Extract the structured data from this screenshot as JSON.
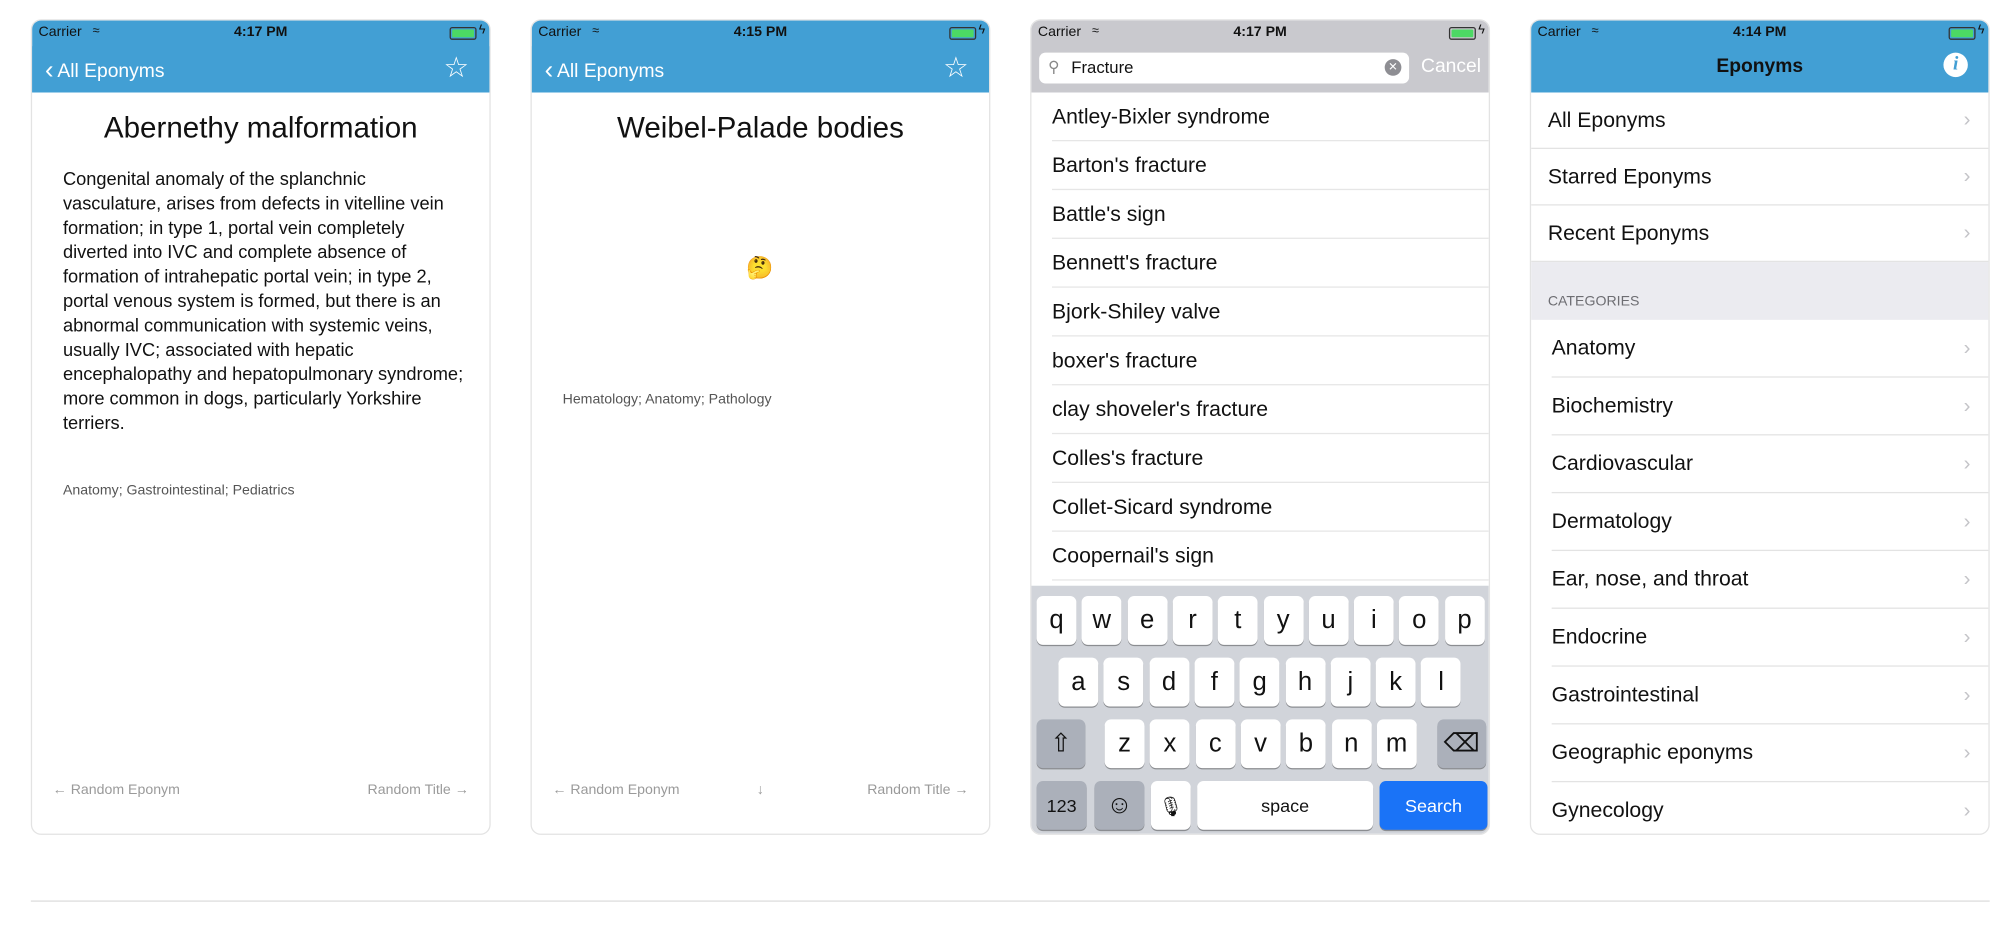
{
  "colors": {
    "nav_blue": "#429fd4",
    "search_key": "#1a73f7",
    "battery": "#4cd964"
  },
  "screen1": {
    "status": {
      "carrier": "Carrier",
      "time": "4:17 PM"
    },
    "back_label": "All Eponyms",
    "title": "Abernethy malformation",
    "description": "Congenital anomaly of the splanchnic vasculature, arises from defects in vitelline vein formation; in type 1, portal vein completely diverted into IVC and complete absence of formation of intrahepatic portal vein; in type 2, portal venous system is formed, but there is an abnormal communication with systemic veins, usually IVC; associated with hepatic encephalopathy and hepatopulmonary syndrome; more common in dogs, particularly Yorkshire terriers.",
    "categories": "Anatomy; Gastrointestinal; Pediatrics",
    "random_eponym": "← Random Eponym",
    "random_title": "Random Title →"
  },
  "screen2": {
    "status": {
      "carrier": "Carrier",
      "time": "4:15 PM"
    },
    "back_label": "All Eponyms",
    "title": "Weibel-Palade bodies",
    "emoji": "🤔",
    "categories": "Hematology; Anatomy; Pathology",
    "random_eponym": "← Random Eponym",
    "down_arrow": "↓",
    "random_title": "Random Title →"
  },
  "screen3": {
    "status": {
      "carrier": "Carrier",
      "time": "4:17 PM"
    },
    "search_value": "Fracture",
    "cancel_label": "Cancel",
    "results": [
      "Antley-Bixler syndrome",
      "Barton's fracture",
      "Battle's sign",
      "Bennett's fracture",
      "Bjork-Shiley valve",
      "boxer's fracture",
      "clay shoveler's fracture",
      "Colles's fracture",
      "Collet-Sicard syndrome",
      "Coopernail's sign"
    ],
    "keyboard": {
      "row1": [
        "q",
        "w",
        "e",
        "r",
        "t",
        "y",
        "u",
        "i",
        "o",
        "p"
      ],
      "row2": [
        "a",
        "s",
        "d",
        "f",
        "g",
        "h",
        "j",
        "k",
        "l"
      ],
      "row3": [
        "z",
        "x",
        "c",
        "v",
        "b",
        "n",
        "m"
      ],
      "numbers": "123",
      "space": "space",
      "search": "Search"
    }
  },
  "screen4": {
    "status": {
      "carrier": "Carrier",
      "time": "4:14 PM"
    },
    "title": "Eponyms",
    "info": "i",
    "menu": [
      "All Eponyms",
      "Starred Eponyms",
      "Recent Eponyms"
    ],
    "section_header": "CATEGORIES",
    "categories": [
      "Anatomy",
      "Biochemistry",
      "Cardiovascular",
      "Dermatology",
      "Ear, nose, and throat",
      "Endocrine",
      "Gastrointestinal",
      "Geographic eponyms",
      "Gynecology"
    ]
  }
}
